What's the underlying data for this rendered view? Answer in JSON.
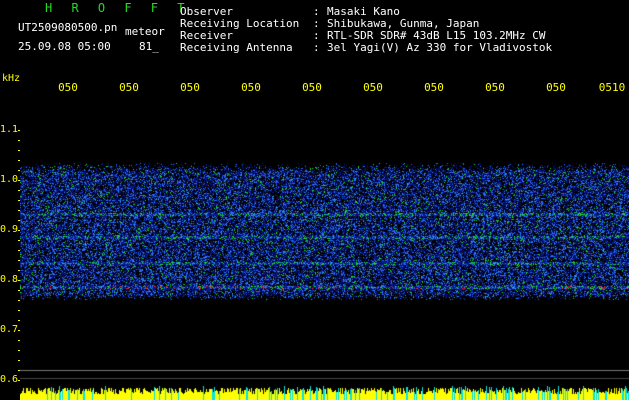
{
  "header": {
    "brand": "H R O F F T",
    "file_name": "UT2509080500.pn",
    "file_suffix": "meteor",
    "date_time": "25.09.08 05:00",
    "count": "81_"
  },
  "info": [
    {
      "label": "Observer",
      "sep": ":",
      "value": "Masaki Kano"
    },
    {
      "label": "Receiving Location",
      "sep": ":",
      "value": "Shibukawa, Gunma, Japan"
    },
    {
      "label": "Receiver",
      "sep": ":",
      "value": "RTL-SDR SDR# 43dB L15 103.2MHz CW"
    },
    {
      "label": "Receiving Antenna",
      "sep": ":",
      "value": "3el Yagi(V) Az 330 for Vladivostok"
    }
  ],
  "y_axis": {
    "unit": "kHz",
    "ticks": [
      "1.1",
      "1.0",
      "0.9",
      "0.8",
      "0.7",
      "0.6"
    ]
  },
  "x_axis": {
    "ticks": [
      "050",
      "050",
      "050",
      "050",
      "050",
      "050",
      "050",
      "050",
      "050",
      "0510"
    ]
  },
  "colors": {
    "background": "#000000",
    "text": "#ffffff",
    "brand": "#22dd22",
    "axis": "#ffff00",
    "noise_low": "#0a1a8c",
    "noise_mid": "#2a6cff",
    "noise_high": "#22dd22",
    "signal_peak": "#ff2020",
    "baseline_bar": "#ffff00",
    "baseline_spike": "#00e5e5"
  }
}
